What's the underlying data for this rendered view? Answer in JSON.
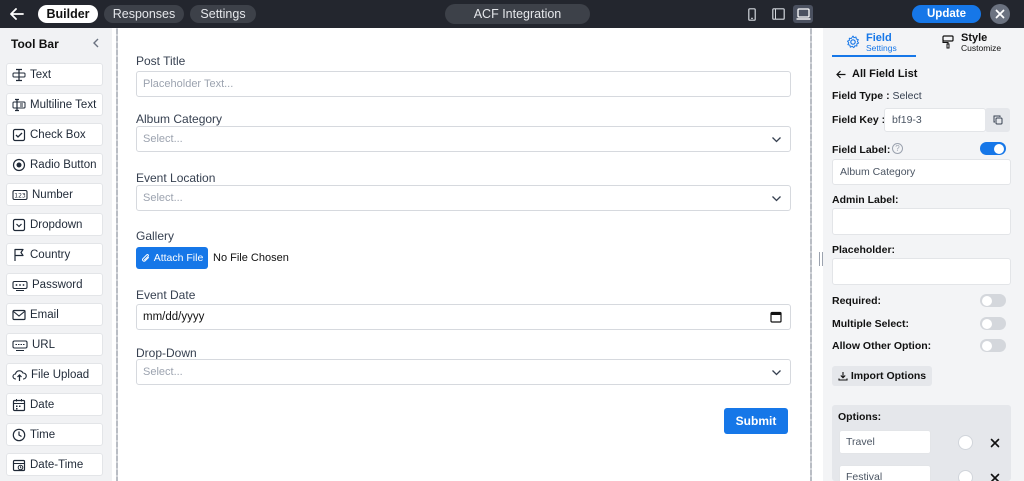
{
  "topbar": {
    "tabs": [
      {
        "label": "Builder",
        "active": true
      },
      {
        "label": "Responses",
        "active": false
      },
      {
        "label": "Settings",
        "active": false
      }
    ],
    "form_title": "ACF Integration",
    "devices": [
      "mobile-icon",
      "tablet-icon",
      "desktop-icon"
    ],
    "active_device": "desktop-icon",
    "update_label": "Update"
  },
  "toolbar": {
    "title": "Tool Bar",
    "items": [
      {
        "label": "Text",
        "icon": "text-cursor-icon"
      },
      {
        "label": "Multiline Text",
        "icon": "multiline-text-icon"
      },
      {
        "label": "Check Box",
        "icon": "checkbox-icon"
      },
      {
        "label": "Radio Button",
        "icon": "radio-button-icon"
      },
      {
        "label": "Number",
        "icon": "number-icon"
      },
      {
        "label": "Dropdown",
        "icon": "dropdown-icon"
      },
      {
        "label": "Country",
        "icon": "flag-icon"
      },
      {
        "label": "Password",
        "icon": "password-icon"
      },
      {
        "label": "Email",
        "icon": "envelope-icon"
      },
      {
        "label": "URL",
        "icon": "url-icon"
      },
      {
        "label": "File Upload",
        "icon": "upload-icon"
      },
      {
        "label": "Date",
        "icon": "calendar-icon"
      },
      {
        "label": "Time",
        "icon": "clock-icon"
      },
      {
        "label": "Date-Time",
        "icon": "date-time-icon"
      }
    ]
  },
  "form": {
    "post_title": {
      "label": "Post Title",
      "placeholder": "Placeholder Text..."
    },
    "album_category": {
      "label": "Album Category",
      "value": "Select..."
    },
    "event_location": {
      "label": "Event Location",
      "value": "Select..."
    },
    "gallery": {
      "label": "Gallery",
      "button_label": "Attach File",
      "status": "No File Chosen"
    },
    "event_date": {
      "label": "Event Date",
      "value": "mm/dd/yyyy"
    },
    "drop_down": {
      "label": "Drop-Down",
      "value": "Select..."
    },
    "submit_label": "Submit"
  },
  "panel": {
    "tabs": [
      {
        "title": "Field",
        "subtitle": "Settings",
        "active": true
      },
      {
        "title": "Style",
        "subtitle": "Customize",
        "active": false
      }
    ],
    "back_label": "All Field List",
    "field_type_label": "Field Type :",
    "field_type_value": "Select",
    "field_key_label": "Field Key :",
    "field_key_value": "bf19-3",
    "field_label_label": "Field Label:",
    "field_label_enabled": true,
    "field_label_value": "Album Category",
    "admin_label_label": "Admin Label:",
    "admin_label_value": "",
    "placeholder_label": "Placeholder:",
    "placeholder_value": "",
    "required_label": "Required:",
    "required": false,
    "multiple_select_label": "Multiple Select:",
    "multiple_select": false,
    "allow_other_label": "Allow Other Option:",
    "allow_other": false,
    "import_label": "Import Options",
    "options_label": "Options:",
    "options": [
      "Travel",
      "Festival"
    ]
  },
  "colors": {
    "accent": "#1677e8",
    "topbar": "#23262e",
    "panel_bg": "#f3f4f6"
  }
}
